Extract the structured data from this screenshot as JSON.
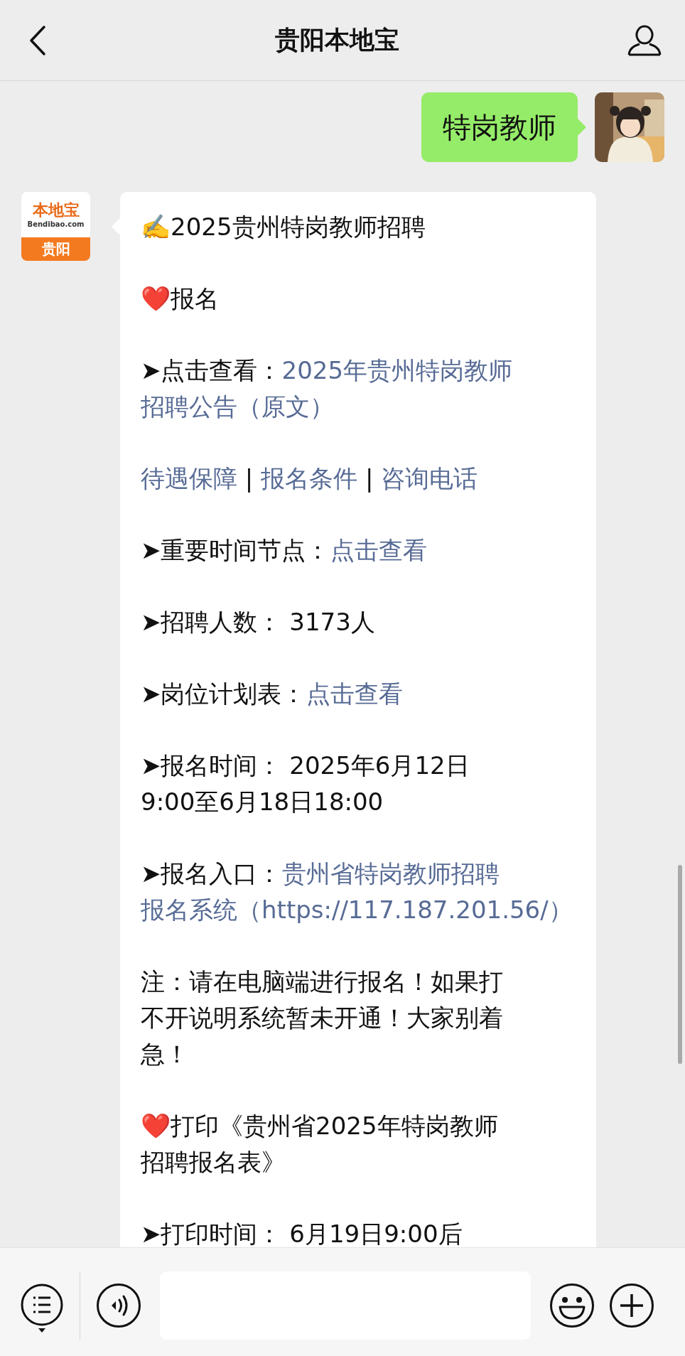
{
  "header": {
    "title": "贵阳本地宝"
  },
  "messages": [
    {
      "kind": "sent",
      "text": "特岗教师"
    },
    {
      "kind": "received",
      "avatar": {
        "brand": "本地宝",
        "site": "Bendibao.com",
        "city": "贵阳"
      },
      "paragraphs": [
        [
          [
            {
              "kind": "plain",
              "text": "✍️2025贵州特岗教师招聘"
            }
          ]
        ],
        [
          [
            {
              "kind": "plain",
              "text": "❤️报名"
            }
          ]
        ],
        [
          [
            {
              "kind": "plain",
              "text": "➤点击查看："
            },
            {
              "kind": "link",
              "text": "2025年贵州特岗教师"
            }
          ],
          [
            {
              "kind": "link",
              "text": "招聘公告（原文）"
            }
          ]
        ],
        [
          [
            {
              "kind": "link",
              "text": "待遇保障"
            },
            {
              "kind": "plain",
              "text": " | "
            },
            {
              "kind": "link",
              "text": "报名条件"
            },
            {
              "kind": "plain",
              "text": " | "
            },
            {
              "kind": "link",
              "text": "咨询电话"
            }
          ]
        ],
        [
          [
            {
              "kind": "plain",
              "text": "➤重要时间节点："
            },
            {
              "kind": "link",
              "text": "点击查看"
            }
          ]
        ],
        [
          [
            {
              "kind": "plain",
              "text": "➤招聘人数： 3173人"
            }
          ]
        ],
        [
          [
            {
              "kind": "plain",
              "text": "➤岗位计划表："
            },
            {
              "kind": "link",
              "text": "点击查看"
            }
          ]
        ],
        [
          [
            {
              "kind": "plain",
              "text": "➤报名时间： 2025年6月12日"
            }
          ],
          [
            {
              "kind": "plain",
              "text": "9:00至6月18日18:00"
            }
          ]
        ],
        [
          [
            {
              "kind": "plain",
              "text": "➤报名入口："
            },
            {
              "kind": "link",
              "text": "贵州省特岗教师招聘"
            }
          ],
          [
            {
              "kind": "link",
              "text": "报名系统（https://117.187.201.56/）"
            }
          ]
        ],
        [
          [
            {
              "kind": "plain",
              "text": "注：请在电脑端进行报名！如果打"
            }
          ],
          [
            {
              "kind": "plain",
              "text": "不开说明系统暂未开通！大家别着"
            }
          ],
          [
            {
              "kind": "plain",
              "text": "急！"
            }
          ]
        ],
        [
          [
            {
              "kind": "plain",
              "text": "❤️打印《贵州省2025年特岗教师"
            }
          ],
          [
            {
              "kind": "plain",
              "text": "招聘报名表》"
            }
          ]
        ],
        [
          [
            {
              "kind": "plain",
              "text": "➤打印时间： 6月19日9:00后"
            }
          ]
        ]
      ]
    }
  ]
}
